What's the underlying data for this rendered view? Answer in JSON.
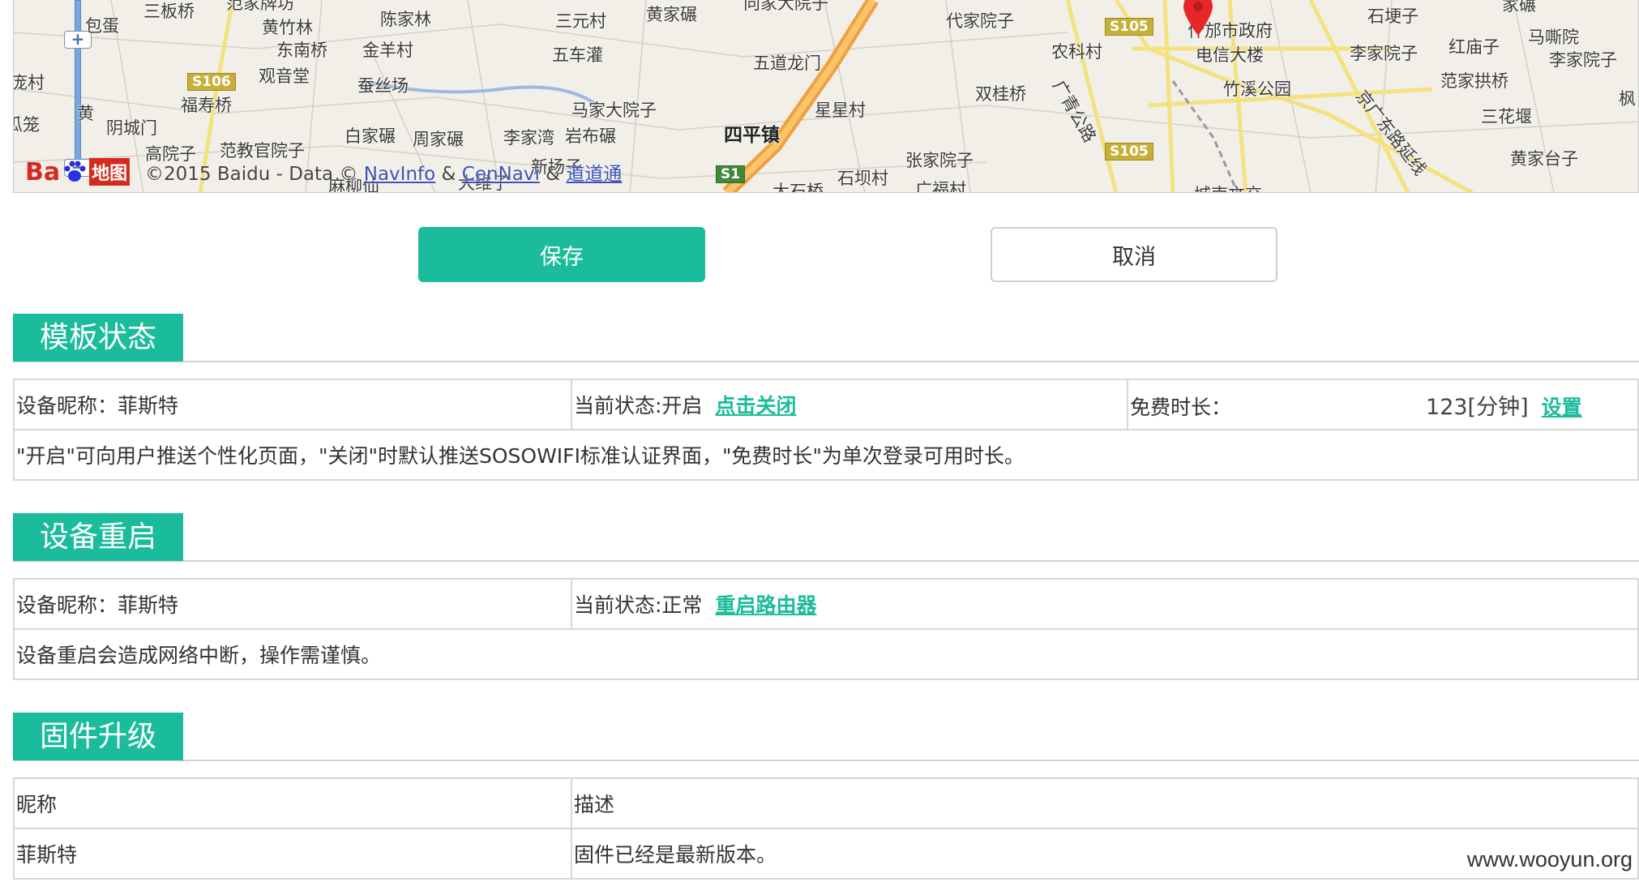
{
  "map": {
    "places": [
      {
        "t": "范家牌坊",
        "b": false
      },
      {
        "t": "三板桥",
        "b": false
      },
      {
        "t": "黄竹林",
        "b": false
      },
      {
        "t": "陈家林",
        "b": false
      },
      {
        "t": "三元村",
        "b": false
      },
      {
        "t": "黄家碾",
        "b": false
      },
      {
        "t": "向家大院子",
        "b": false
      },
      {
        "t": "代家院子",
        "b": false
      },
      {
        "t": "什邡市政府",
        "b": false
      },
      {
        "t": "电信大楼",
        "b": false
      },
      {
        "t": "农科村",
        "b": false
      },
      {
        "t": "石埂子",
        "b": false
      },
      {
        "t": "马嘶院",
        "b": false
      },
      {
        "t": "李家院子",
        "b": false
      },
      {
        "t": "红庙子",
        "b": false
      },
      {
        "t": "李家院子",
        "b": false
      },
      {
        "t": "包蛋",
        "b": false
      },
      {
        "t": "东南桥",
        "b": false
      },
      {
        "t": "金羊村",
        "b": false
      },
      {
        "t": "五车灌",
        "b": false
      },
      {
        "t": "五道龙门",
        "b": false
      },
      {
        "t": "观音堂",
        "b": false
      },
      {
        "t": "蚕丝场",
        "b": false
      },
      {
        "t": "范家拱桥",
        "b": false
      },
      {
        "t": "竹溪公园",
        "b": false
      },
      {
        "t": "福寿桥",
        "b": false
      },
      {
        "t": "双桂桥",
        "b": false
      },
      {
        "t": "星星村",
        "b": false
      },
      {
        "t": "马家大院子",
        "b": false
      },
      {
        "t": "三花堰",
        "b": false
      },
      {
        "t": "阴城门",
        "b": false
      },
      {
        "t": "白家碾",
        "b": false
      },
      {
        "t": "周家碾",
        "b": false
      },
      {
        "t": "李家湾",
        "b": false
      },
      {
        "t": "岩布碾",
        "b": false
      },
      {
        "t": "四平镇",
        "b": true
      },
      {
        "t": "高院子",
        "b": false
      },
      {
        "t": "范教官院子",
        "b": false
      },
      {
        "t": "张家院子",
        "b": false
      },
      {
        "t": "黄家台子",
        "b": false
      },
      {
        "t": "石坝村",
        "b": false
      },
      {
        "t": "大石桥",
        "b": false
      },
      {
        "t": "广福村",
        "b": false
      },
      {
        "t": "城南文交",
        "b": false
      },
      {
        "t": "新场子",
        "b": false
      },
      {
        "t": "大维子",
        "b": false
      },
      {
        "t": "麻柳仙",
        "b": false
      },
      {
        "t": "京广东路延线",
        "b": false
      },
      {
        "t": "广青公路",
        "b": false
      },
      {
        "t": "庞村",
        "b": false
      },
      {
        "t": "黄",
        "b": false
      },
      {
        "t": "瓜笼",
        "b": false
      },
      {
        "t": "枫",
        "b": false
      },
      {
        "t": "家碾",
        "b": false
      }
    ],
    "shields": [
      "S106",
      "S105",
      "S105",
      "S1"
    ],
    "copyright": {
      "prefix": "©2015 Baidu - Data ©",
      "link1": "NavInfo",
      "amp1": "&",
      "link2": "CenNavi",
      "amp2": "&",
      "link3": "道道通"
    },
    "logo_text": "Ba",
    "logo_map": "地图",
    "zoom_in": "+",
    "zoom_out": "−"
  },
  "actions": {
    "save_label": "保存",
    "cancel_label": "取消"
  },
  "template_status": {
    "title": "模板状态",
    "device_nickname": "设备昵称：菲斯特",
    "current_state": "当前状态:开启",
    "toggle_link": "点击关闭",
    "free_time_label": "免费时长：",
    "free_time_value": "123[分钟]",
    "set_link": "设置",
    "note": "\"开启\"可向用户推送个性化页面，\"关闭\"时默认推送SOSOWIFI标准认证界面，\"免费时长\"为单次登录可用时长。"
  },
  "device_restart": {
    "title": "设备重启",
    "device_nickname": "设备昵称：菲斯特",
    "current_state": "当前状态:正常",
    "restart_link": "重启路由器",
    "note": "设备重启会造成网络中断，操作需谨慎。"
  },
  "firmware": {
    "title": "固件升级",
    "headers": [
      "昵称",
      "描述"
    ],
    "rows": [
      [
        "菲斯特",
        "固件已经是最新版本。"
      ]
    ]
  },
  "watermark": "www.wooyun.org",
  "colors": {
    "accent": "#1bbc9b",
    "map_bg": "#f2efe8",
    "road_yellow": "#f6e48a",
    "highway": "#f0a040"
  }
}
